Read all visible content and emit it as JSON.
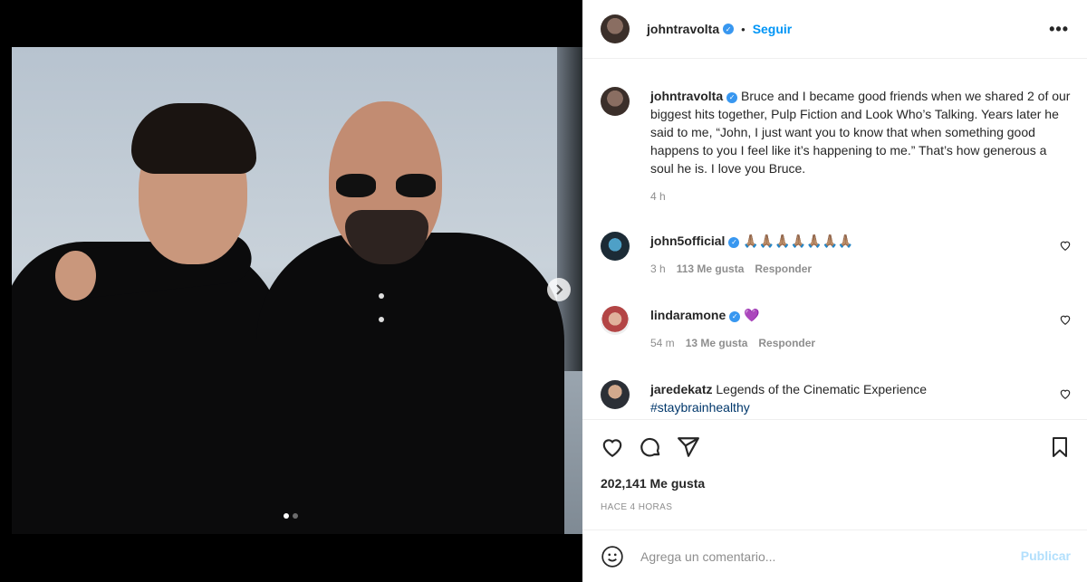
{
  "post": {
    "username": "johntravolta",
    "follow_label": "Seguir",
    "separator": "•",
    "more_label": "•••",
    "caption": "Bruce and I became good friends when we shared 2 of our biggest hits together, Pulp Fiction and Look Who’s Talking. Years later he said to me, “John, I just want you to know that when something good happens to you I feel like it’s happening to me.” That’s how generous a soul he is. I love you Bruce.",
    "caption_age": "4 h",
    "carousel": {
      "current": 1,
      "total": 2
    }
  },
  "comments": [
    {
      "username": "john5official",
      "verified": true,
      "text": "🙏🏽🙏🏽🙏🏽🙏🏽🙏🏽🙏🏽🙏🏽",
      "age": "3 h",
      "likes": "113 Me gusta",
      "reply": "Responder"
    },
    {
      "username": "lindaramone",
      "verified": true,
      "text": "💜",
      "age": "54 m",
      "likes": "13 Me gusta",
      "reply": "Responder"
    },
    {
      "username": "jaredekatz",
      "verified": false,
      "text": "Legends of the Cinematic Experience",
      "hashtag": "#staybrainhealthy"
    }
  ],
  "engagement": {
    "likes": "202,141 Me gusta",
    "time": "HACE 4 HORAS"
  },
  "composer": {
    "placeholder": "Agrega un comentario...",
    "publish_label": "Publicar"
  },
  "icons": {
    "verified": "verified-badge-icon",
    "like": "heart-icon",
    "comment": "comment-icon",
    "share": "paper-plane-icon",
    "save": "bookmark-icon",
    "emoji": "smiley-icon",
    "next": "chevron-right-icon"
  },
  "colors": {
    "accent": "#0095f6",
    "verified": "#3897f0",
    "publish_disabled": "#b2dffc",
    "meta_text": "#8e8e8e"
  }
}
